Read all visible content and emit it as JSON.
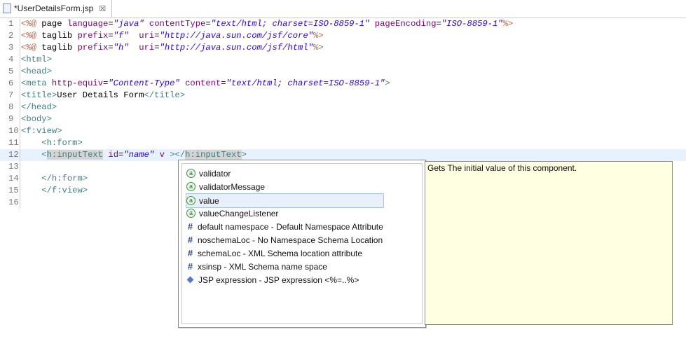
{
  "tab": {
    "title": "*UserDetailsForm.jsp",
    "close_icon": "close-icon"
  },
  "editor": {
    "current_line": 12,
    "lines": [
      {
        "num": "1",
        "parts": [
          [
            "dir",
            "<%@"
          ],
          [
            "txt",
            " page "
          ],
          [
            "attr",
            "language"
          ],
          [
            "txt",
            "="
          ],
          [
            "val",
            "\"java\""
          ],
          [
            "txt",
            " "
          ],
          [
            "attr",
            "contentType"
          ],
          [
            "txt",
            "="
          ],
          [
            "val",
            "\"text/html; charset=ISO-8859-1\""
          ],
          [
            "txt",
            " "
          ],
          [
            "attr",
            "pageEncoding"
          ],
          [
            "txt",
            "="
          ],
          [
            "val",
            "\"ISO-8859-1\""
          ],
          [
            "dir",
            "%>"
          ]
        ]
      },
      {
        "num": "2",
        "parts": [
          [
            "dir",
            "<%@"
          ],
          [
            "txt",
            " taglib "
          ],
          [
            "attr",
            "prefix"
          ],
          [
            "txt",
            "="
          ],
          [
            "val",
            "\"f\""
          ],
          [
            "txt",
            "  "
          ],
          [
            "attr",
            "uri"
          ],
          [
            "txt",
            "="
          ],
          [
            "val",
            "\"http://java.sun.com/jsf/core\""
          ],
          [
            "dir",
            "%>"
          ]
        ]
      },
      {
        "num": "3",
        "parts": [
          [
            "dir",
            "<%@"
          ],
          [
            "txt",
            " taglib "
          ],
          [
            "attr",
            "prefix"
          ],
          [
            "txt",
            "="
          ],
          [
            "val",
            "\"h\""
          ],
          [
            "txt",
            "  "
          ],
          [
            "attr",
            "uri"
          ],
          [
            "txt",
            "="
          ],
          [
            "val",
            "\"http://java.sun.com/jsf/html\""
          ],
          [
            "dir",
            "%>"
          ]
        ]
      },
      {
        "num": "4",
        "parts": [
          [
            "tag",
            "<html>"
          ]
        ]
      },
      {
        "num": "5",
        "parts": [
          [
            "tag",
            "<head>"
          ]
        ]
      },
      {
        "num": "6",
        "parts": [
          [
            "tag",
            "<meta "
          ],
          [
            "attr",
            "http-equiv"
          ],
          [
            "txt",
            "="
          ],
          [
            "val",
            "\"Content-Type\""
          ],
          [
            "txt",
            " "
          ],
          [
            "attr",
            "content"
          ],
          [
            "txt",
            "="
          ],
          [
            "val",
            "\"text/html; charset=ISO-8859-1\""
          ],
          [
            "tag",
            ">"
          ]
        ]
      },
      {
        "num": "7",
        "parts": [
          [
            "tag",
            "<title>"
          ],
          [
            "txt",
            "User Details Form"
          ],
          [
            "tag",
            "</title>"
          ]
        ]
      },
      {
        "num": "8",
        "parts": [
          [
            "tag",
            "</head>"
          ]
        ]
      },
      {
        "num": "9",
        "parts": [
          [
            "tag",
            "<body>"
          ]
        ]
      },
      {
        "num": "10",
        "parts": [
          [
            "tag",
            "<f:view>"
          ]
        ]
      },
      {
        "num": "11",
        "parts": [
          [
            "txt",
            "    "
          ],
          [
            "tag",
            "<h:form>"
          ]
        ]
      },
      {
        "num": "12",
        "parts": [
          [
            "txt",
            "    "
          ],
          [
            "tag",
            "<"
          ],
          [
            "tagh",
            "h:inputText"
          ],
          [
            "txt",
            " "
          ],
          [
            "attr",
            "id"
          ],
          [
            "txt",
            "="
          ],
          [
            "val",
            "\"name\""
          ],
          [
            "txt",
            " "
          ],
          [
            "attr",
            "v"
          ],
          [
            "txt",
            " "
          ],
          [
            "tag",
            "></"
          ],
          [
            "tagh",
            "h:inputText"
          ],
          [
            "tag",
            ">"
          ]
        ]
      },
      {
        "num": "13",
        "parts": []
      },
      {
        "num": "14",
        "parts": [
          [
            "txt",
            "    "
          ],
          [
            "tag",
            "</h:form>"
          ]
        ]
      },
      {
        "num": "15",
        "parts": [
          [
            "txt",
            "    "
          ],
          [
            "tag",
            "</f:view>"
          ]
        ]
      },
      {
        "num": "16",
        "parts": []
      }
    ]
  },
  "completion": {
    "items": [
      {
        "label": "validator",
        "icon": "attribute-icon"
      },
      {
        "label": "validatorMessage",
        "icon": "attribute-icon"
      },
      {
        "label": "value",
        "icon": "attribute-icon",
        "selected": true
      },
      {
        "label": "valueChangeListener",
        "icon": "attribute-icon"
      },
      {
        "label": "default namespace - Default Namespace Attribute",
        "icon": "namespace-icon"
      },
      {
        "label": "noschemaLoc - No Namespace Schema Location",
        "icon": "namespace-icon"
      },
      {
        "label": "schemaLoc - XML Schema location attribute",
        "icon": "namespace-icon"
      },
      {
        "label": "xsinsp - XML Schema name space",
        "icon": "namespace-icon"
      },
      {
        "label": "JSP expression - JSP expression <%=..%>",
        "icon": "jsp-expression-icon"
      }
    ],
    "doc_text": "Gets The initial value of this component."
  },
  "colors": {
    "current_line": "#e8f2fe",
    "doc_bg": "#ffffe1",
    "tag": "#3f7f7f",
    "attr": "#7f007f",
    "value": "#2a00ff"
  }
}
